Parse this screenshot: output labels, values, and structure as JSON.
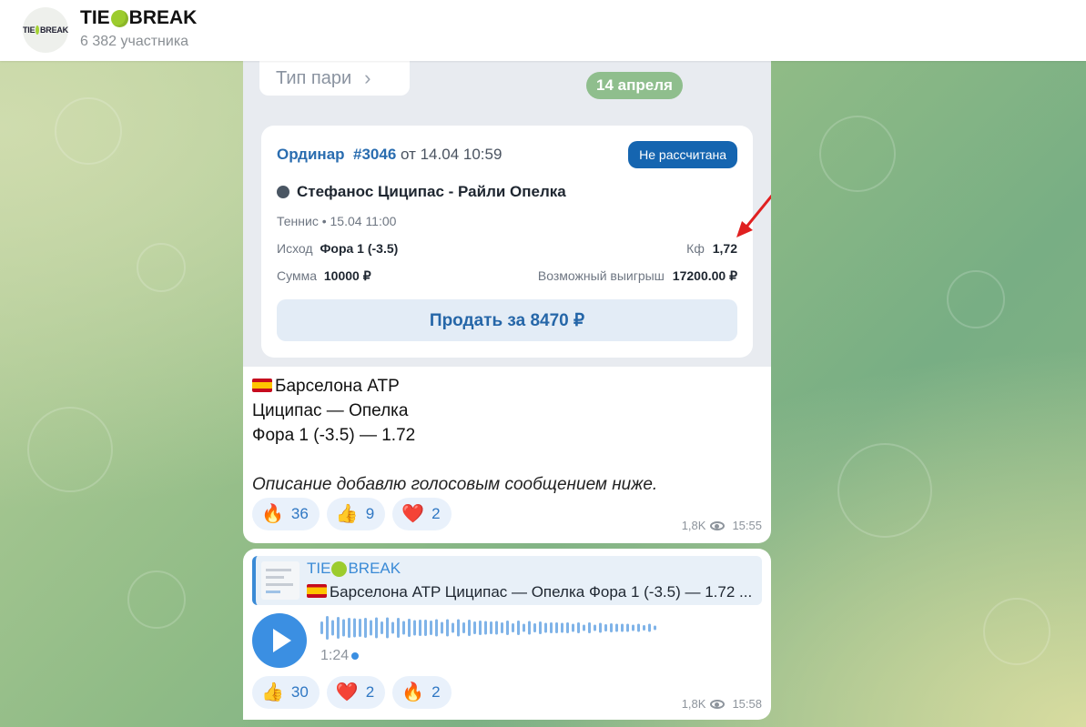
{
  "header": {
    "title_part1": "TIE",
    "title_part2": "BREAK",
    "subscribers": "6 382 участника",
    "avatar_part1": "TIE",
    "avatar_part2": "BREAK"
  },
  "message1": {
    "type_pill": "Тип пари",
    "date": "14 апреля",
    "bet": {
      "kind": "Ординар",
      "number": "#3046",
      "datetime": "от 14.04 10:59",
      "status": "Не рассчитана",
      "match": "Стефанос Циципас - Райли Опелка",
      "sport_time": "Теннис • 15.04 11:00",
      "outcome_label": "Исход",
      "outcome_value": "Фора 1 (-3.5)",
      "coef_label": "Кф",
      "coef_value": "1,72",
      "sum_label": "Сумма",
      "sum_value": "10000 ₽",
      "win_label": "Возможный выигрыш",
      "win_value": "17200.00 ₽",
      "sell_button": "Продать за 8470 ₽"
    },
    "text": {
      "line1": "Барселона ATP",
      "line2": "Циципас — Опелка",
      "line3": "Фора 1 (-3.5) — 1.72",
      "line4": "Описание добавлю голосовым сообщением ниже."
    },
    "reactions": [
      {
        "emoji": "🔥",
        "count": "36"
      },
      {
        "emoji": "👍",
        "count": "9"
      },
      {
        "emoji": "❤️",
        "count": "2"
      }
    ],
    "views": "1,8K",
    "time": "15:55"
  },
  "message2": {
    "reply": {
      "title_part1": "TIE",
      "title_part2": "BREAK",
      "text": "Барселона ATP Циципас — Опелка Фора 1 (-3.5) — 1.72 ..."
    },
    "voice": {
      "duration": "1:24"
    },
    "reactions": [
      {
        "emoji": "👍",
        "count": "30"
      },
      {
        "emoji": "❤️",
        "count": "2"
      },
      {
        "emoji": "🔥",
        "count": "2"
      }
    ],
    "views": "1,8K",
    "time": "15:58"
  },
  "colors": {
    "accent": "#3b8fe2",
    "badge": "#1565b0",
    "date_pill": "#8fbe8d"
  }
}
